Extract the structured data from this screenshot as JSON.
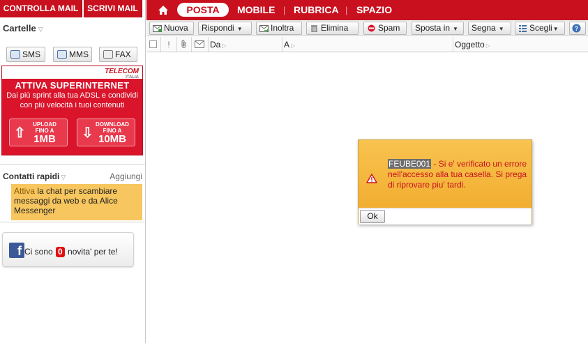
{
  "left": {
    "controlla_label": "CONTROLLA MAIL",
    "scrivi_label": "SCRIVI MAIL",
    "folders_label": "Cartelle",
    "sms_label": "SMS",
    "mms_label": "MMS",
    "fax_label": "FAX",
    "banner": {
      "logo": "TELECOM",
      "logo_sub": "ITALIA",
      "title": "ATTIVA SUPERINTERNET",
      "description": "Dai più sprint alla tua ADSL e condividi con più velocità i tuoi contenuti",
      "upload_line1": "UPLOAD",
      "upload_line2": "FINO A",
      "upload_value": "1MB",
      "download_line1": "DOWNLOAD",
      "download_line2": "FINO A",
      "download_value": "10MB"
    },
    "contacts_label": "Contatti rapidi",
    "add_label": "Aggiungi",
    "chat_highlight": "Attiva",
    "chat_text": " la chat per scambiare messaggi da web e da Alice Messenger",
    "facebook": {
      "before": "Ci sono ",
      "count": "0",
      "after": " novita' per te!"
    }
  },
  "nav": {
    "posta": "POSTA",
    "mobile": "MOBILE",
    "rubrica": "RUBRICA",
    "spazio": "SPAZIO",
    "separator": "|"
  },
  "toolbar": {
    "nuova": "Nuova",
    "rispondi": "Rispondi",
    "inoltra": "Inoltra",
    "elimina": "Elimina",
    "spam": "Spam",
    "sposta": "Sposta in",
    "segna": "Segna",
    "scegli": "Scegli"
  },
  "columns": {
    "priority": "!",
    "da": "Da",
    "a": "A",
    "oggetto": "Oggetto"
  },
  "dialog": {
    "code": "FEUBE001",
    "message": " - Si e' verificato un errore nell'accesso alla tua casella. Si prega di riprovare piu' tardi.",
    "ok_label": "Ok"
  },
  "colors": {
    "brand_red": "#c8101e",
    "dialog_orange": "#f0a92a",
    "chat_yellow": "#f7c65e",
    "facebook_blue": "#3b5998"
  }
}
